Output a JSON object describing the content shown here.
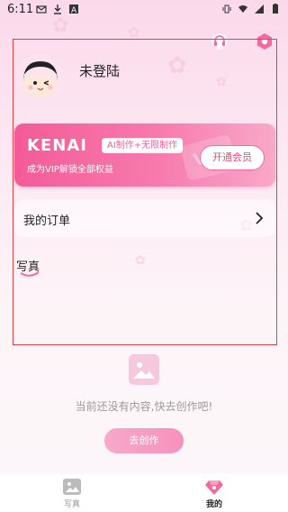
{
  "status_bar": {
    "time": "6:11",
    "left_icons": [
      "mail-icon",
      "download-icon",
      "text-icon"
    ],
    "right_icons": [
      "vibrate-icon",
      "wifi-icon",
      "signal-icon",
      "battery-icon"
    ]
  },
  "top_actions": {
    "icons": [
      "customer-service-icon",
      "settings-icon"
    ]
  },
  "profile": {
    "username": "未登陆",
    "avatar_icon": "avatar-icon"
  },
  "vip": {
    "logo": "KENAI",
    "tag": "AI制作+无限制作",
    "subtitle": "成为VIP解锁全部权益",
    "watermark": "VIP",
    "button_label": "开通会员",
    "accent": "#f45b98"
  },
  "orders": {
    "label": "我的订单",
    "icon": "chevron-right-icon"
  },
  "photos": {
    "title": "写真"
  },
  "empty_state": {
    "icon": "image-placeholder-icon",
    "message": "当前还没有内容,快去创作吧!",
    "button_label": "去创作"
  },
  "bottom_nav": {
    "items": [
      {
        "label": "写真",
        "icon": "photo-icon",
        "active": false
      },
      {
        "label": "我的",
        "icon": "diamond-icon",
        "active": true
      }
    ]
  },
  "colors": {
    "highlight_frame": "#e0424a",
    "primary_pink": "#f45b98"
  }
}
